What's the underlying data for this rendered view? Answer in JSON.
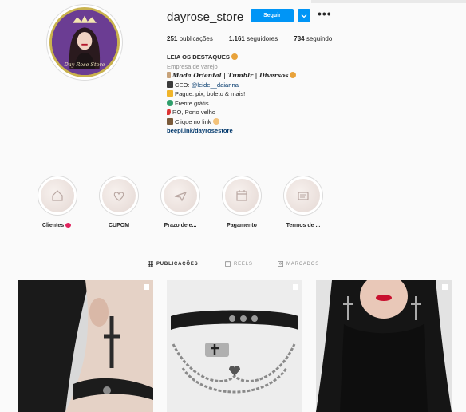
{
  "profile": {
    "username": "dayrose_store",
    "follow_label": "Seguir",
    "avatar_text": "Day Rose Store"
  },
  "stats": {
    "posts_count": "251",
    "posts_label": "publicações",
    "followers_count": "1.161",
    "followers_label": "seguidores",
    "following_count": "734",
    "following_label": "seguindo"
  },
  "bio": {
    "line1": "LEIA OS DESTAQUES",
    "category": "Empresa de varejo",
    "line3": "𝑴𝒐𝒅𝒂 𝑶𝒓𝒊𝒆𝒏𝒕𝒂𝒍 | 𝑻𝒖𝒎𝒃𝒍𝒓 | 𝑫𝒊𝒗𝒆𝒓𝒔𝒐𝒔",
    "ceo_prefix": "CEO: ",
    "ceo_mention": "@leide__daianna",
    "payment": "Pague: pix, boleto & mais!",
    "shipping": "Frente grátis",
    "location": "RO, Porto velho",
    "click": "Clique no link",
    "link": "beepl.ink/dayrosestore"
  },
  "highlights": [
    {
      "label": "Clientes"
    },
    {
      "label": "CUPOM"
    },
    {
      "label": "Prazo de e..."
    },
    {
      "label": "Pagamento"
    },
    {
      "label": "Termos de ..."
    }
  ],
  "tabs": [
    {
      "label": "PUBLICAÇÕES"
    },
    {
      "label": "REELS"
    },
    {
      "label": "MARCADOS"
    }
  ],
  "colors": {
    "accent": "#0095f6",
    "text": "#262626",
    "muted": "#8e8e8e",
    "link": "#00376b",
    "background": "#fafafa"
  }
}
